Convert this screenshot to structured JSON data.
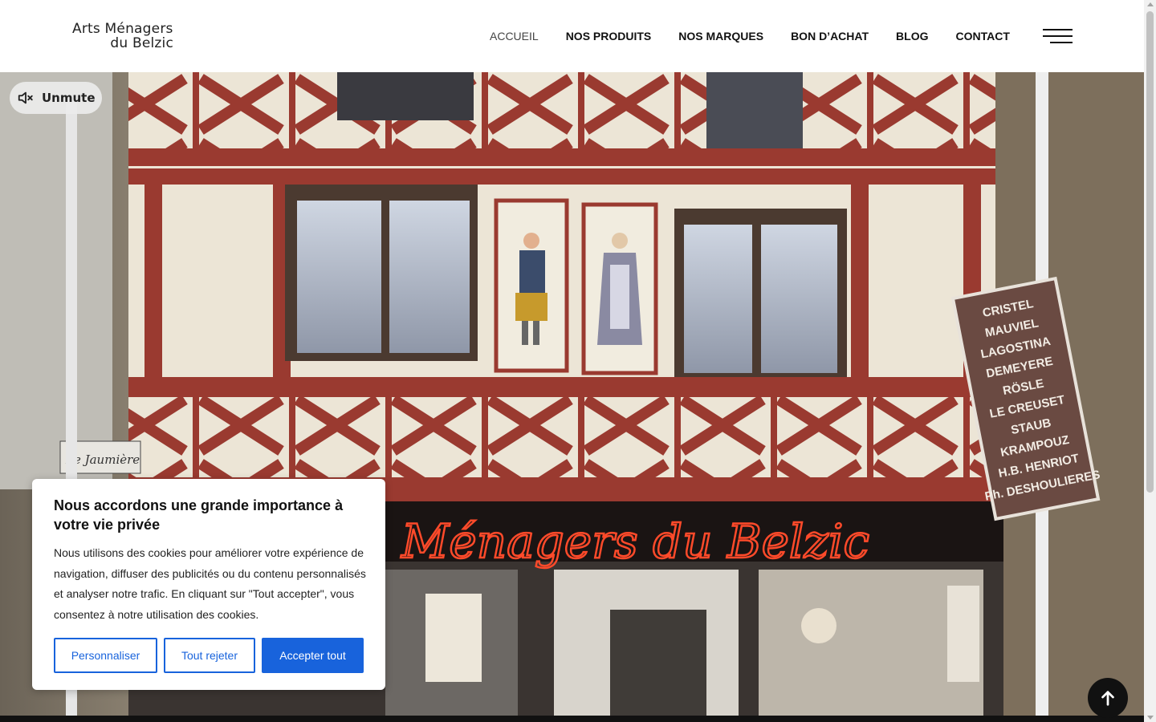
{
  "header": {
    "logo_line1": "Arts Ménagers",
    "logo_line2": "du Belzic",
    "nav": [
      {
        "label": "ACCUEIL",
        "active": true
      },
      {
        "label": "NOS PRODUITS"
      },
      {
        "label": "NOS MARQUES"
      },
      {
        "label": "BON D’ACHAT"
      },
      {
        "label": "BLOG"
      },
      {
        "label": "CONTACT"
      }
    ],
    "menu_icon": "hamburger-icon"
  },
  "video": {
    "unmute_label": "Unmute",
    "unmute_icon": "speaker-muted-icon",
    "neon_sign": "Ménagers du Belzic",
    "street_sign": "Le Jaumière",
    "brands_sign": [
      "CRISTEL",
      "MAUVIEL",
      "LAGOSTINA",
      "DEMEYERE",
      "RÖSLE",
      "LE CREUSET",
      "STAUB",
      "KRAMPOUZ",
      "H.B. HENRIOT",
      "Ph. DESHOULIERES"
    ]
  },
  "cookie_banner": {
    "title": "Nous accordons une grande importance à votre vie privée",
    "text": "Nous utilisons des cookies pour améliorer votre expérience de navigation, diffuser des publicités ou du contenu personnalisés et analyser notre trafic. En cliquant sur \"Tout accepter\", vous consentez à notre utilisation des cookies.",
    "customize_label": "Personnaliser",
    "reject_label": "Tout rejeter",
    "accept_label": "Accepter tout",
    "accent_color": "#1863dc"
  },
  "back_to_top_icon": "arrow-up-icon",
  "colors": {
    "timber": "#9a3a30",
    "plaster": "#ece5d6",
    "neon": "#ff4a2a"
  }
}
